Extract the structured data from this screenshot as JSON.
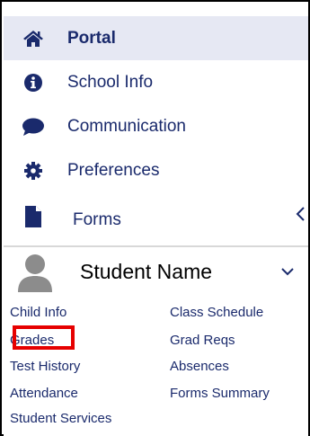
{
  "nav": {
    "items": [
      {
        "label": "Portal",
        "icon": "home-icon"
      },
      {
        "label": "School Info",
        "icon": "info-icon"
      },
      {
        "label": "Communication",
        "icon": "chat-bubble-icon"
      },
      {
        "label": "Preferences",
        "icon": "gear-icon"
      },
      {
        "label": "Forms",
        "icon": "document-icon"
      }
    ]
  },
  "student": {
    "name": "Student Name"
  },
  "student_links": {
    "left": [
      "Child Info",
      "Grades",
      "Test History",
      "Attendance",
      "Student Services"
    ],
    "right": [
      "Class Schedule",
      "Grad Reqs",
      "Absences",
      "Forms Summary"
    ]
  },
  "colors": {
    "nav_text": "#1a2a6c",
    "active_bg": "#e6e8f3",
    "highlight": "#e60000"
  }
}
